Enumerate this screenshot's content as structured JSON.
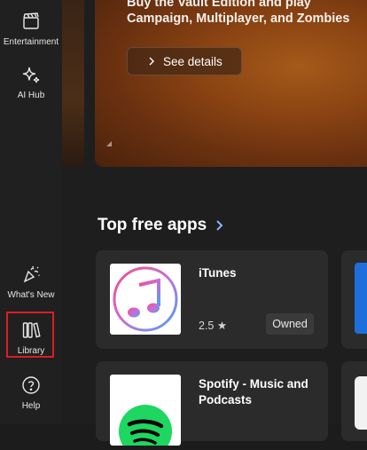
{
  "sidebar": {
    "items": [
      {
        "label": "Entertainment",
        "icon": "clapperboard-icon"
      },
      {
        "label": "AI Hub",
        "icon": "sparkle-icon"
      },
      {
        "label": "What's New",
        "icon": "party-popper-icon"
      },
      {
        "label": "Library",
        "icon": "library-books-icon"
      },
      {
        "label": "Help",
        "icon": "help-circle-icon"
      }
    ]
  },
  "hero": {
    "line1": "Buy the Vault Edition and play",
    "line2": "Campaign, Multiplayer, and Zombies",
    "button_label": "See details"
  },
  "section": {
    "title": "Top free apps"
  },
  "apps": [
    {
      "name": "iTunes",
      "rating": "2.5 ★",
      "status": "Owned"
    },
    {
      "name": "Spotify - Music and Podcasts"
    }
  ],
  "colors": {
    "highlight": "#e01b24",
    "accent_arrow": "#8ab4f8"
  }
}
